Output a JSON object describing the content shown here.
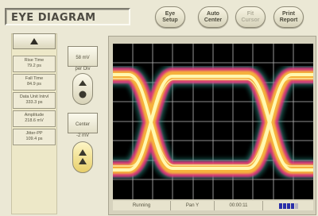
{
  "header": {
    "title": "EYE DIAGRAM",
    "buttons": [
      {
        "label": "Eye\nSetup",
        "enabled": true
      },
      {
        "label": "Auto\nCenter",
        "enabled": true
      },
      {
        "label": "Fit\nCursor",
        "enabled": false
      },
      {
        "label": "Print\nReport",
        "enabled": true
      }
    ]
  },
  "measurements": [
    {
      "name": "Rise Time",
      "value": "79.2 ps"
    },
    {
      "name": "Fall Time",
      "value": "84.9 ps"
    },
    {
      "name": "Data Unit Intrvl",
      "value": "333.3 ps"
    },
    {
      "name": "Amplitude",
      "value": "218.6 mV"
    },
    {
      "name": "Jitter-PP",
      "value": "109.4 ps"
    }
  ],
  "controls": {
    "scale": {
      "line1": "58 mV",
      "line2": "per Div"
    },
    "center": {
      "line1": "Center",
      "line2": "-2 mV"
    }
  },
  "status": {
    "state": "Running",
    "axis": "Pan Y",
    "time": "00:00:11",
    "progress_fraction": 0.8
  },
  "colors": {
    "scope_background": "#000000",
    "grid": "#cfcfcf",
    "trace_hot": "#fff8b0",
    "trace_warm": "#f6b23a",
    "trace_mid": "#e8317e",
    "trace_cool": "#2fa89a",
    "progress_block": "#2a2fa8"
  }
}
